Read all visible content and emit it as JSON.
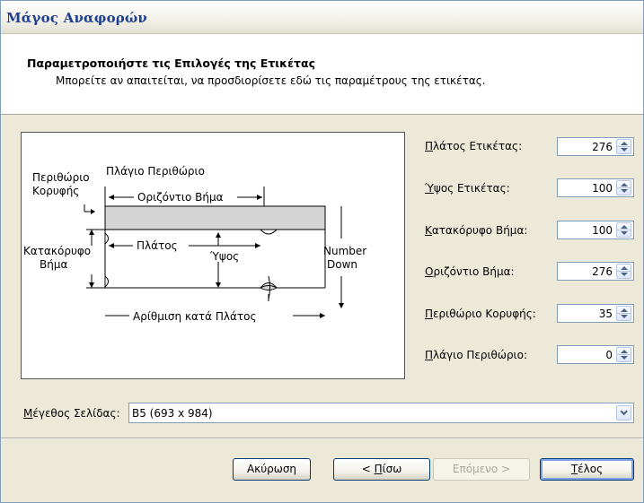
{
  "window": {
    "title": "Μάγος Αναφορών"
  },
  "header": {
    "heading": "Παραμετροποιήστε τις Επιλογές της Ετικέτας",
    "subheading": "Μπορείτε αν απαιτείται, να προσδιορίσετε εδώ τις παραμέτρους της ετικέτας."
  },
  "diagram": {
    "top_margin_label_1": "Περιθώριο",
    "top_margin_label_2": "Κορυφής",
    "side_margin_label": "Πλάγιο Περιθώριο",
    "horizontal_pitch_label": "Οριζόντιο Βήμα",
    "vertical_pitch_label_1": "Κατακόρυφο",
    "vertical_pitch_label_2": "Βήμα",
    "width_label": "Πλάτος",
    "height_label": "Ύψος",
    "number_down_label_1": "Number",
    "number_down_label_2": "Down",
    "number_across_label": "Αρίθμιση κατά Πλάτος"
  },
  "fields": [
    {
      "mnemonic": "Π",
      "rest": "λάτος Ετικέτας:",
      "value": "276"
    },
    {
      "mnemonic": "Ύ",
      "rest": "ψος Ετικέτας:",
      "value": "100"
    },
    {
      "mnemonic": "Κ",
      "rest": "ατακόρυφο Βήμα:",
      "value": "100"
    },
    {
      "mnemonic": "Ο",
      "rest": "ριζόντιο Βήμα:",
      "value": "276"
    },
    {
      "mnemonic": "Π",
      "rest": "εριθώριο Κορυφής:",
      "value": "35"
    },
    {
      "mnemonic": "Π",
      "rest": "λάγιο Περιθώριο:",
      "value": "0"
    }
  ],
  "page_size": {
    "label_mnemonic": "Μ",
    "label_rest": "έγεθος Σελίδας:",
    "value": "B5 (693 x 984)"
  },
  "buttons": {
    "cancel": "Ακύρωση",
    "back_prefix": "< ",
    "back_mnemonic": "Π",
    "back_rest": "ίσω",
    "next": "Επόμενο >",
    "finish_mnemonic": "Τ",
    "finish_rest": "έλος"
  },
  "colors": {
    "title_text": "#1f3f8f",
    "window_bg": "#ece9d8",
    "label_band": "#d4d4d4"
  },
  "icons": [
    "spin-up-icon",
    "spin-down-icon",
    "dropdown-arrow-icon"
  ]
}
